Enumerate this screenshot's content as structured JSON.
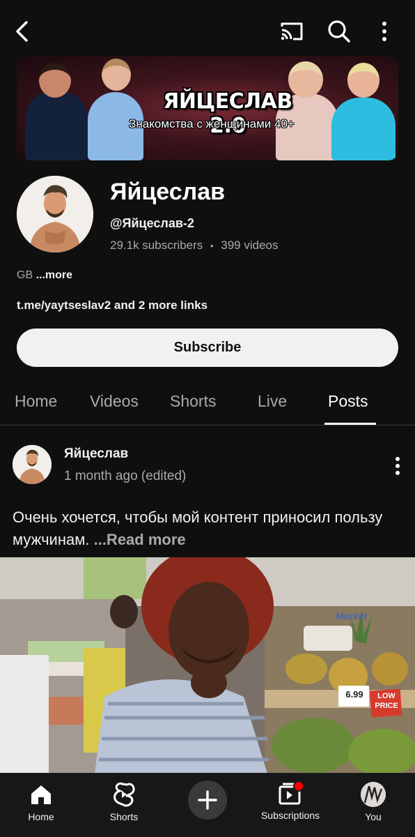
{
  "icons": {
    "back": "back-arrow-icon",
    "cast": "cast-icon",
    "search": "search-icon",
    "menu": "more-vert-icon"
  },
  "banner": {
    "title": "ЯЙЦЕСЛАВ 2.0",
    "subtitle": "Знакомства с женщинами 40+"
  },
  "channel": {
    "name": "Яйцеслав",
    "handle": "@Яйцеслав-2",
    "subscribers": "29.1k subscribers",
    "separator": "•",
    "videos": "399 videos",
    "description": "GB",
    "more_label": "...more",
    "links": "t.me/yaytseslav2 and 2 more links",
    "subscribe_label": "Subscribe"
  },
  "tabs": [
    {
      "label": "Home"
    },
    {
      "label": "Videos"
    },
    {
      "label": "Shorts"
    },
    {
      "label": "Live"
    },
    {
      "label": "Posts",
      "active": true
    }
  ],
  "post": {
    "author": "Яйцеслав",
    "time": "1 month ago (edited)",
    "text": "Очень хочется, чтобы мой контент приносил пользу мужчинам.",
    "read_more": "...Read more",
    "image_price_tag": "6.99",
    "image_low_price": "LOW PRICE",
    "image_store_sign": "Market"
  },
  "bottom_nav": [
    {
      "label": "Home",
      "icon": "home-icon"
    },
    {
      "label": "Shorts",
      "icon": "shorts-icon"
    },
    {
      "label": "",
      "icon": "create-plus-icon"
    },
    {
      "label": "Subscriptions",
      "icon": "subscriptions-icon"
    },
    {
      "label": "You",
      "icon": "avatar"
    }
  ],
  "colors": {
    "background": "#0f0f0f",
    "subscribe_bg": "#f1f1f1",
    "secondary_text": "#aaaaaa",
    "notification_dot": "#ff0000",
    "low_price_badge": "#d73a2b"
  }
}
